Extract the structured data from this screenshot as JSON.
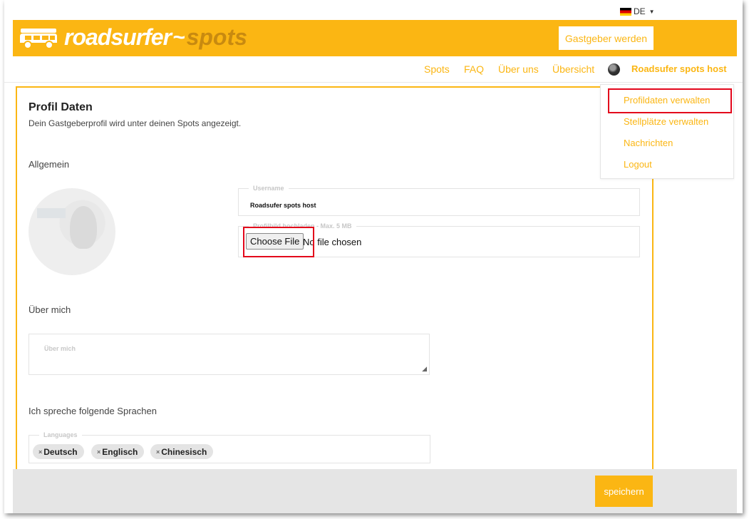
{
  "lang": {
    "code": "DE",
    "flag_icon": "germany-flag-icon"
  },
  "brand": {
    "name_part1": "roadsurfer",
    "name_part2": "spots",
    "accent": "#fbb613"
  },
  "header": {
    "host_button": "Gastgeber werden"
  },
  "nav": {
    "links": [
      "Spots",
      "FAQ",
      "Über uns",
      "Übersicht"
    ],
    "user": "Roadsufer spots host"
  },
  "profile_menu": {
    "items": [
      "Profildaten verwalten",
      "Stellplätze verwalten",
      "Nachrichten",
      "Logout"
    ]
  },
  "page": {
    "title": "Profil Daten",
    "subtitle": "Dein Gastgeberprofil wird unter deinen Spots angezeigt.",
    "section_general": "Allgemein",
    "username_label": "Username",
    "username_value": "Roadsufer spots host",
    "upload_label": "Profilbild hochladen - Max. 5 MB",
    "file_button": "Choose File",
    "file_status": "No file chosen",
    "section_about": "Über mich",
    "about_placeholder": "Über mich",
    "section_languages": "Ich spreche folgende Sprachen",
    "languages_label": "Languages",
    "languages": [
      "Deutsch",
      "Englisch",
      "Chinesisch"
    ]
  },
  "footer": {
    "save_button": "speichern"
  },
  "colors": {
    "highlight": "#e3061b",
    "footer_bg": "#e5e5e5"
  }
}
